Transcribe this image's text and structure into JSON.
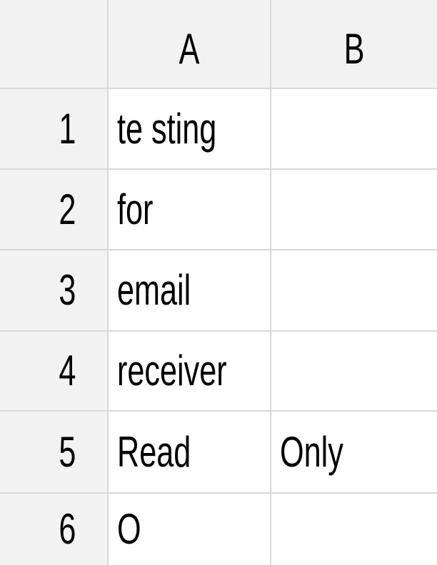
{
  "spreadsheet": {
    "columns": [
      "A",
      "B"
    ],
    "rows": [
      {
        "number": "1",
        "cells": [
          "te sting",
          ""
        ]
      },
      {
        "number": "2",
        "cells": [
          "for",
          ""
        ]
      },
      {
        "number": "3",
        "cells": [
          "email",
          ""
        ]
      },
      {
        "number": "4",
        "cells": [
          "receiver",
          ""
        ]
      },
      {
        "number": "5",
        "cells": [
          "Read",
          "Only"
        ]
      },
      {
        "number": "6",
        "cells": [
          "O",
          ""
        ]
      }
    ]
  },
  "colors": {
    "header_background": "#f2f2f2",
    "gridline": "#d9d9d9",
    "text": "#000000"
  }
}
